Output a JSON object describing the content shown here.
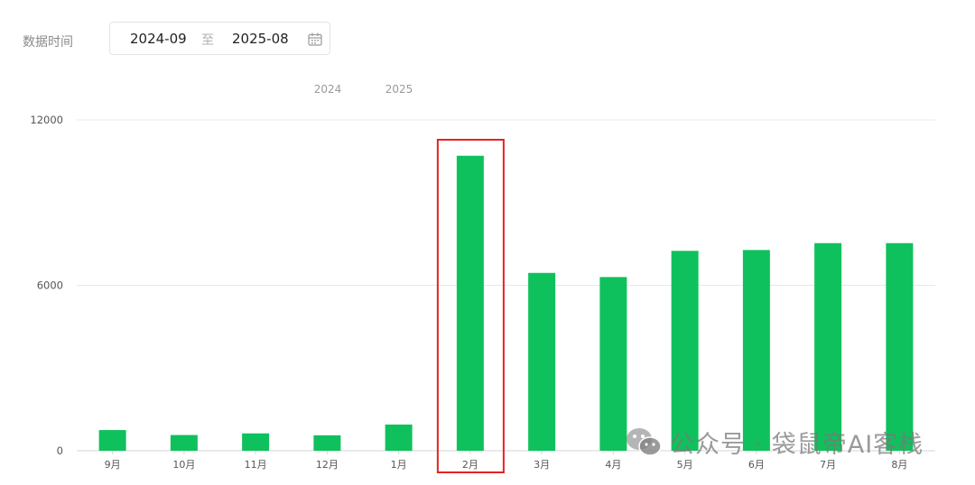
{
  "filter": {
    "label": "数据时间",
    "start": "2024-09",
    "separator": "至",
    "end": "2025-08",
    "calendar_icon": "calendar-icon"
  },
  "watermark": {
    "text": "公众号 · 袋鼠帝AI客栈",
    "icon": "wechat-icon"
  },
  "chart_data": {
    "type": "bar",
    "year_labels": [
      "2024",
      "2025"
    ],
    "categories": [
      "9月",
      "10月",
      "11月",
      "12月",
      "1月",
      "2月",
      "3月",
      "4月",
      "5月",
      "6月",
      "7月",
      "8月"
    ],
    "values": [
      750,
      570,
      630,
      560,
      950,
      10700,
      6450,
      6300,
      7250,
      7280,
      7530,
      7530
    ],
    "ylim": [
      0,
      12000
    ],
    "yticks": [
      0,
      6000,
      12000
    ],
    "grid": true,
    "bar_color": "#0fc15c",
    "highlight": {
      "category": "2月",
      "color": "#e52222"
    },
    "title": "",
    "xlabel": "",
    "ylabel": ""
  }
}
